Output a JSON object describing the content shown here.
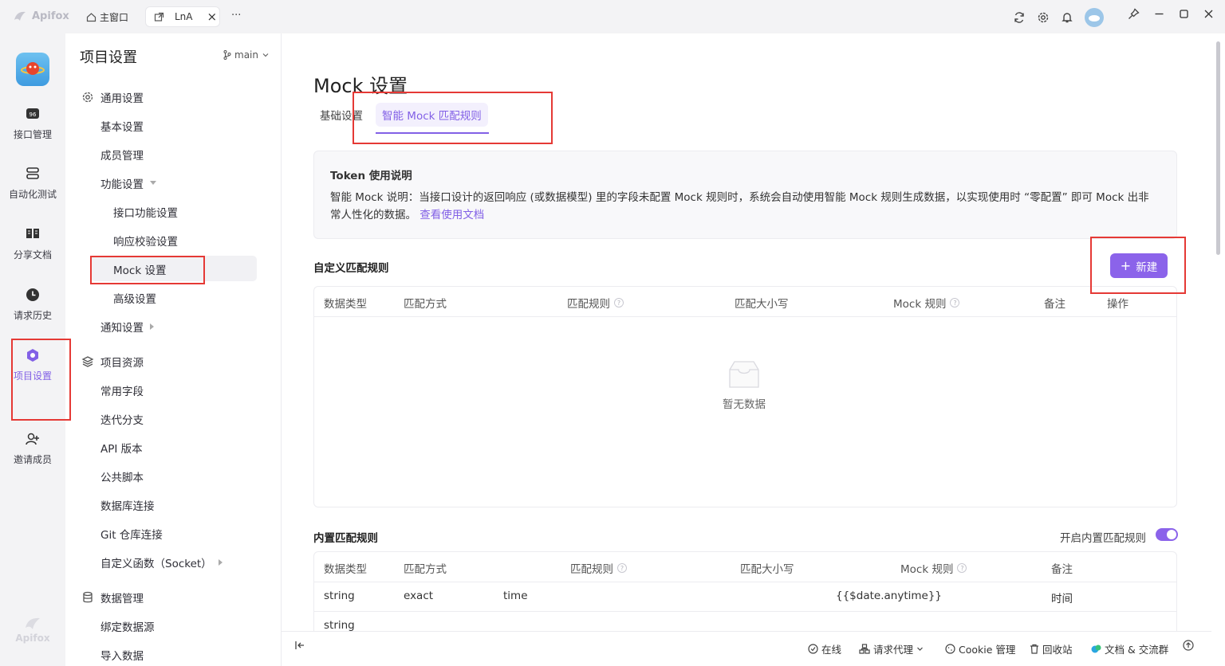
{
  "titlebar": {
    "app_name": "Apifox",
    "home_tab": "主窗口",
    "project_tab": "LnA",
    "close_glyph": "×",
    "more_glyph": "···"
  },
  "rail": {
    "items": [
      {
        "label": "接口管理",
        "icon": "api-icon"
      },
      {
        "label": "自动化测试",
        "icon": "stack-icon"
      },
      {
        "label": "分享文档",
        "icon": "book-icon"
      },
      {
        "label": "请求历史",
        "icon": "clock-icon"
      },
      {
        "label": "项目设置",
        "icon": "settings-hex-icon",
        "active": true
      },
      {
        "label": "邀请成员",
        "icon": "add-user-icon"
      }
    ],
    "footer_logo": "Apifox"
  },
  "nav": {
    "title": "项目设置",
    "branch": "main",
    "general": "通用设置",
    "basic": "基本设置",
    "members": "成员管理",
    "features": "功能设置",
    "api_features": "接口功能设置",
    "response_validation": "响应校验设置",
    "mock": "Mock 设置",
    "advanced": "高级设置",
    "notify": "通知设置",
    "resources": "项目资源",
    "common_fields": "常用字段",
    "iteration_branch": "迭代分支",
    "api_version": "API 版本",
    "public_scripts": "公共脚本",
    "db_conn": "数据库连接",
    "git_conn": "Git 仓库连接",
    "custom_func": "自定义函数（Socket）",
    "data_mgmt": "数据管理",
    "bind_datasource": "绑定数据源",
    "import_data": "导入数据"
  },
  "main": {
    "title": "Mock 设置",
    "tabs": [
      "基础设置",
      "智能 Mock 匹配规则"
    ],
    "tip_title": "Token 使用说明",
    "tip_text": "智能 Mock 说明：当接口设计的返回响应 (或数据模型) 里的字段未配置 Mock 规则时，系统会自动使用智能 Mock 规则生成数据，以实现使用时 “零配置” 即可 Mock 出非常人性化的数据。",
    "tip_link": "查看使用文档",
    "custom_title": "自定义匹配规则",
    "new_button": "新建",
    "custom_headers": [
      "数据类型",
      "匹配方式",
      "匹配规则",
      "匹配大小写",
      "Mock 规则",
      "备注",
      "操作"
    ],
    "empty_text": "暂无数据",
    "builtin_title": "内置匹配规则",
    "builtin_toggle_label": "开启内置匹配规则",
    "builtin_headers": [
      "数据类型",
      "匹配方式",
      "匹配规则",
      "匹配大小写",
      "Mock 规则",
      "备注"
    ],
    "builtin_rows": [
      {
        "type": "string",
        "mode": "exact",
        "rule": "time",
        "mock": "{{$date.anytime}}",
        "note": "时间"
      },
      {
        "type": "string",
        "mode": "",
        "rule": "",
        "mock": "",
        "note": ""
      }
    ]
  },
  "status": {
    "online": "在线",
    "proxy": "请求代理",
    "cookie": "Cookie 管理",
    "recycle": "回收站",
    "docs": "文档 & 交流群"
  },
  "colors": {
    "accent": "#8b63ea",
    "highlight": "#e53935"
  }
}
